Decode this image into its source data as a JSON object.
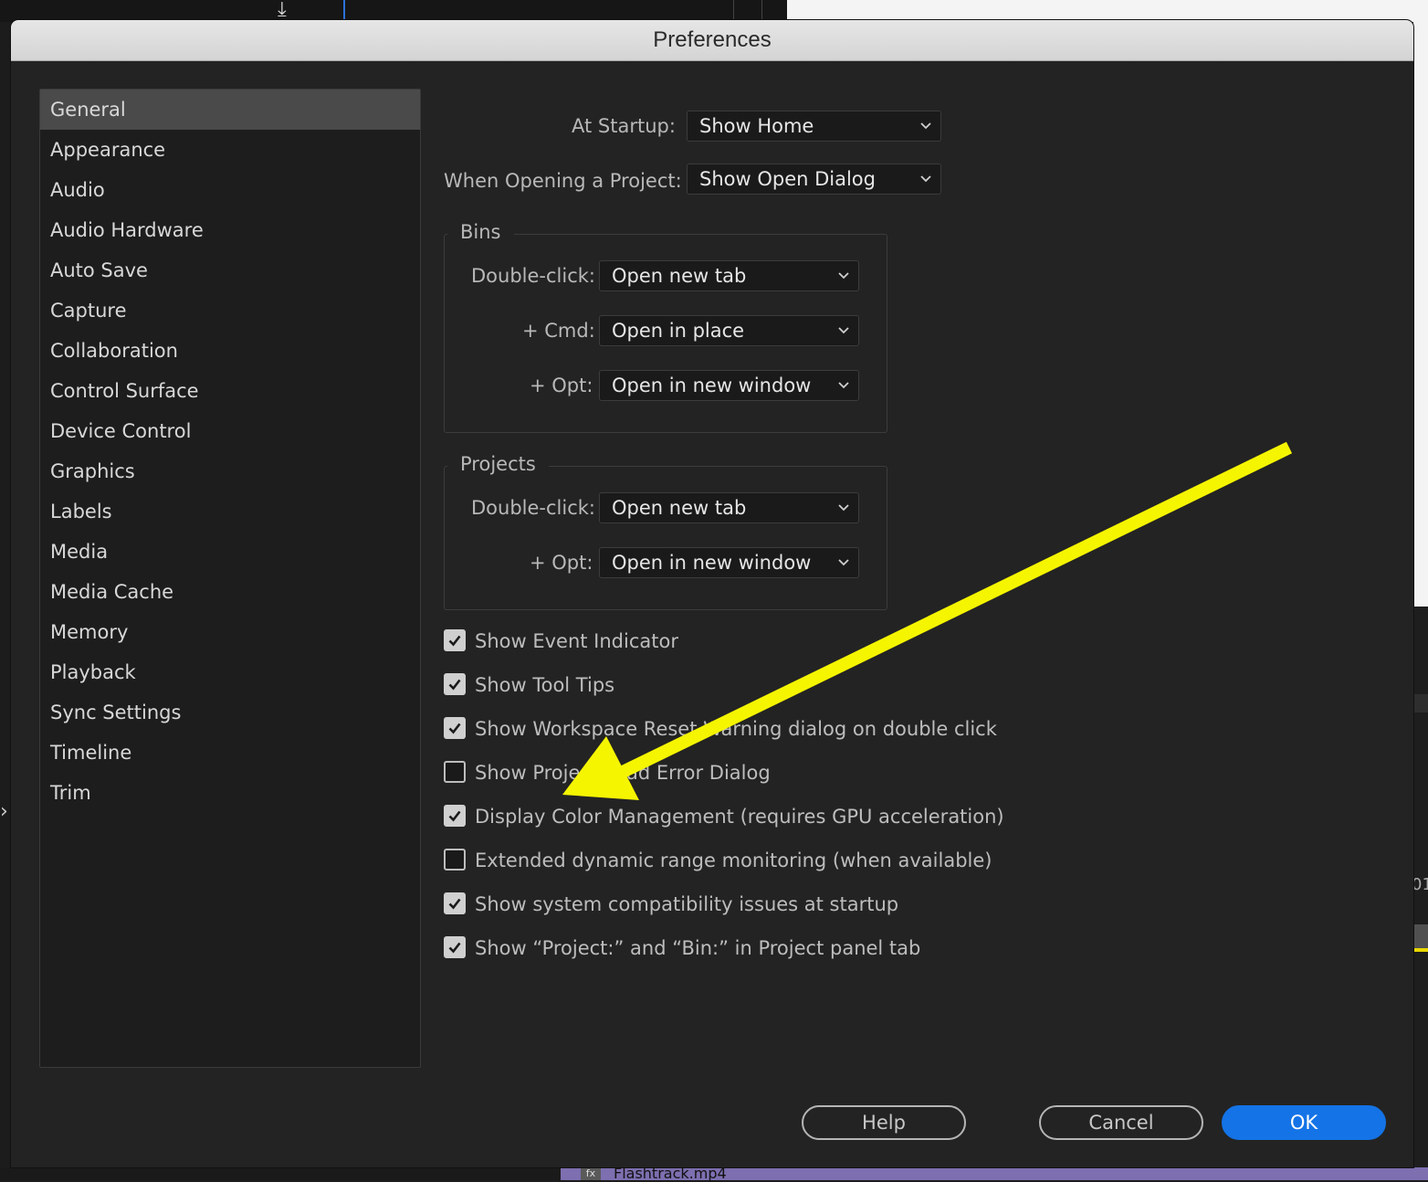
{
  "window": {
    "title": "Preferences"
  },
  "sidebar": {
    "items": [
      {
        "label": "General",
        "selected": true
      },
      {
        "label": "Appearance"
      },
      {
        "label": "Audio"
      },
      {
        "label": "Audio Hardware"
      },
      {
        "label": "Auto Save"
      },
      {
        "label": "Capture"
      },
      {
        "label": "Collaboration"
      },
      {
        "label": "Control Surface"
      },
      {
        "label": "Device Control"
      },
      {
        "label": "Graphics"
      },
      {
        "label": "Labels"
      },
      {
        "label": "Media"
      },
      {
        "label": "Media Cache"
      },
      {
        "label": "Memory"
      },
      {
        "label": "Playback"
      },
      {
        "label": "Sync Settings"
      },
      {
        "label": "Timeline"
      },
      {
        "label": "Trim"
      }
    ]
  },
  "general": {
    "at_startup": {
      "label": "At Startup:",
      "value": "Show Home"
    },
    "when_opening": {
      "label": "When Opening a Project:",
      "value": "Show Open Dialog"
    },
    "bins": {
      "title": "Bins",
      "double_click": {
        "label": "Double-click:",
        "value": "Open new tab"
      },
      "cmd": {
        "label": "+ Cmd:",
        "value": "Open in place"
      },
      "opt": {
        "label": "+ Opt:",
        "value": "Open in new window"
      }
    },
    "projects": {
      "title": "Projects",
      "double_click": {
        "label": "Double-click:",
        "value": "Open new tab"
      },
      "opt": {
        "label": "+ Opt:",
        "value": "Open in new window"
      }
    },
    "checkboxes": [
      {
        "label": "Show Event Indicator",
        "checked": true
      },
      {
        "label": "Show Tool Tips",
        "checked": true
      },
      {
        "label": "Show Workspace Reset Warning dialog on double click",
        "checked": true
      },
      {
        "label": "Show Project Load Error Dialog",
        "checked": false
      },
      {
        "label": "Display Color Management (requires GPU acceleration)",
        "checked": true
      },
      {
        "label": "Extended dynamic range monitoring (when available)",
        "checked": false
      },
      {
        "label": "Show system compatibility issues at startup",
        "checked": true
      },
      {
        "label": "Show “Project:” and “Bin:” in Project panel tab",
        "checked": true
      }
    ]
  },
  "buttons": {
    "help": "Help",
    "cancel": "Cancel",
    "ok": "OK"
  },
  "background": {
    "clip_name": "Flashtrack.mp4",
    "fx_badge": "fx",
    "side_text": "01"
  },
  "colors": {
    "accent": "#1473e6",
    "annotation_arrow": "#f5f500"
  },
  "icons": {
    "dropdown": "chevron-down-icon",
    "check": "checkmark-icon",
    "annotation": "arrow-annotation-icon"
  }
}
